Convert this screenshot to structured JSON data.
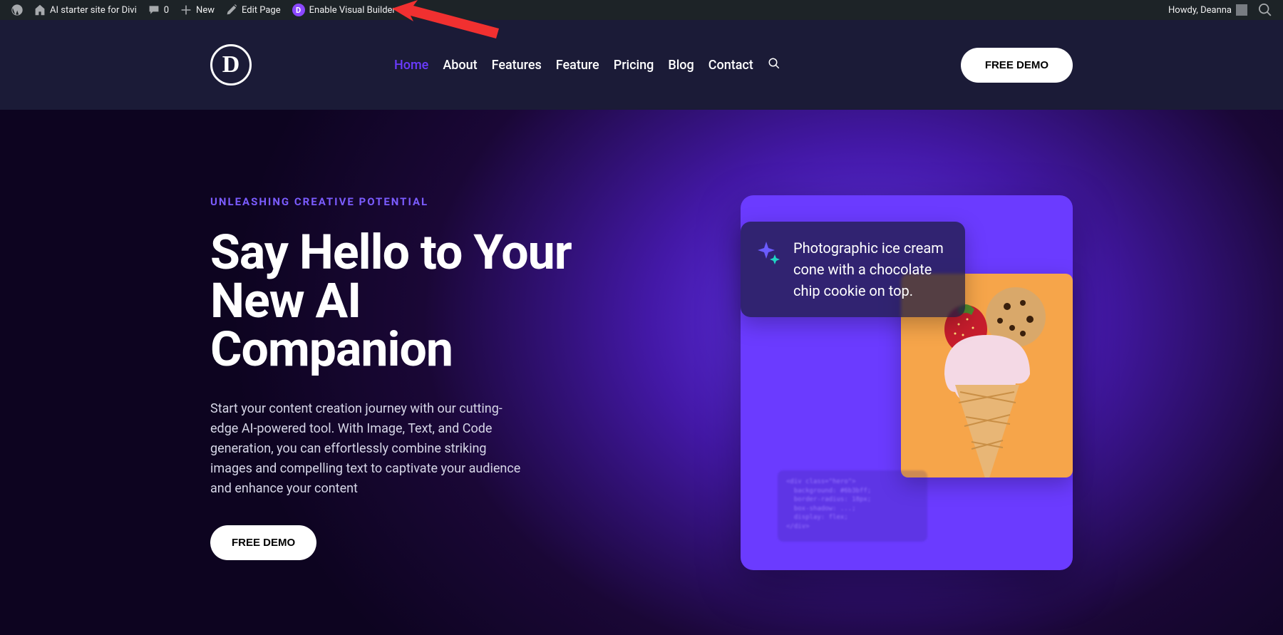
{
  "adminbar": {
    "site_name": "AI starter site for Divi",
    "comments_count": "0",
    "new_label": "New",
    "edit_page_label": "Edit Page",
    "enable_vb_label": "Enable Visual Builder",
    "howdy_text": "Howdy, Deanna"
  },
  "annotation": {
    "type": "arrow",
    "color": "#f13030",
    "points_to": "enable-visual-builder-link"
  },
  "header": {
    "logo_letter": "D",
    "nav": [
      {
        "label": "Home",
        "active": true
      },
      {
        "label": "About",
        "active": false
      },
      {
        "label": "Features",
        "active": false
      },
      {
        "label": "Feature",
        "active": false
      },
      {
        "label": "Pricing",
        "active": false
      },
      {
        "label": "Blog",
        "active": false
      },
      {
        "label": "Contact",
        "active": false
      }
    ],
    "cta_label": "FREE DEMO"
  },
  "hero": {
    "eyebrow": "UNLEASHING CREATIVE POTENTIAL",
    "title": "Say Hello to Your New AI Companion",
    "body": "Start your content creation journey with our cutting-edge AI-powered tool. With Image, Text, and Code generation, you can effortlessly combine striking images and compelling text to captivate your audience and enhance your content",
    "cta_label": "FREE DEMO",
    "prompt_text": "Photographic ice cream cone with a chocolate chip cookie on top.",
    "image_alt": "ice-cream-cone-with-strawberry-and-cookie"
  }
}
